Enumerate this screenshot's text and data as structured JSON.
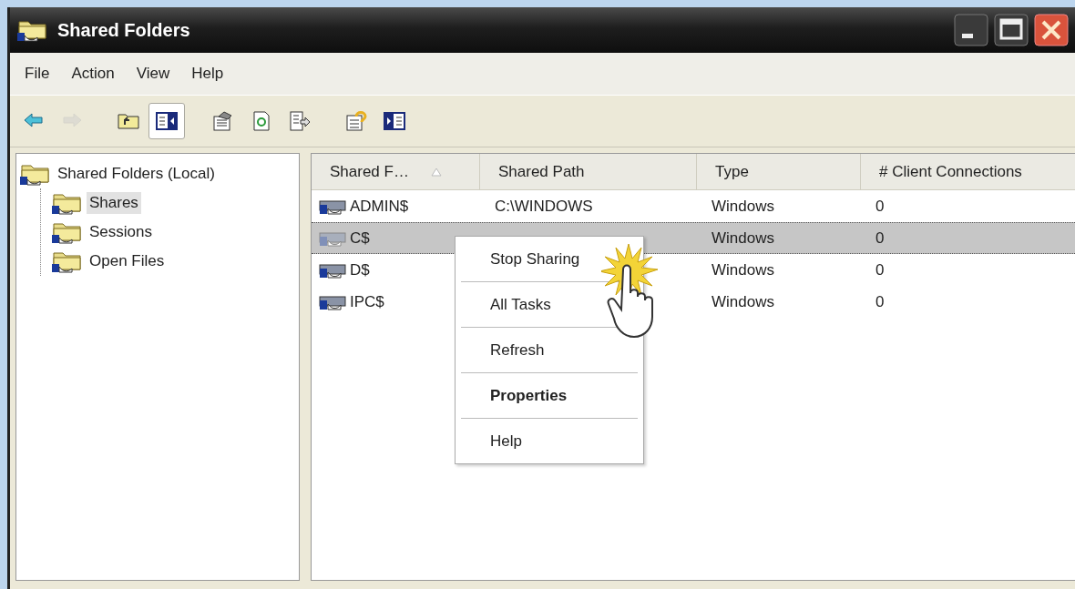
{
  "window": {
    "title": "Shared Folders"
  },
  "menu_bar": [
    "File",
    "Action",
    "View",
    "Help"
  ],
  "toolbar": [
    {
      "kind": "back",
      "disabled": false,
      "pressed": false
    },
    {
      "kind": "forward",
      "disabled": true,
      "pressed": false
    },
    {
      "kind": "up",
      "disabled": false,
      "pressed": false
    },
    {
      "kind": "tree-toggle",
      "disabled": false,
      "pressed": true
    },
    {
      "kind": "properties",
      "disabled": false,
      "pressed": false
    },
    {
      "kind": "refresh",
      "disabled": false,
      "pressed": false
    },
    {
      "kind": "export",
      "disabled": false,
      "pressed": false
    },
    {
      "kind": "help",
      "disabled": false,
      "pressed": false
    },
    {
      "kind": "action-pane",
      "disabled": false,
      "pressed": false
    }
  ],
  "tree": {
    "label": "Shared Folders (Local)",
    "selected": false,
    "children": [
      {
        "label": "Shares",
        "selected": true
      },
      {
        "label": "Sessions",
        "selected": false
      },
      {
        "label": "Open Files",
        "selected": false
      }
    ]
  },
  "table": {
    "columns": [
      {
        "label": "Shared F…",
        "sorted": true
      },
      {
        "label": "Shared Path",
        "sorted": false
      },
      {
        "label": "Type",
        "sorted": false
      },
      {
        "label": "# Client Connections",
        "sorted": false
      }
    ],
    "rows": [
      {
        "name": "ADMIN$",
        "path": "C:\\WINDOWS",
        "type": "Windows",
        "connections": "0",
        "selected": false
      },
      {
        "name": "C$",
        "type": "Windows",
        "connections": "0",
        "selected": true
      },
      {
        "name": "D$",
        "type": "Windows",
        "connections": "0",
        "selected": false
      },
      {
        "name": "IPC$",
        "type": "Windows",
        "connections": "0",
        "selected": false
      }
    ]
  },
  "context_menu": {
    "items": [
      {
        "label": "Stop Sharing",
        "default": false
      },
      {
        "label": "All Tasks",
        "default": false
      },
      {
        "label": "Refresh",
        "default": false
      },
      {
        "label": "Properties",
        "default": true
      },
      {
        "label": "Help",
        "default": false
      }
    ]
  }
}
